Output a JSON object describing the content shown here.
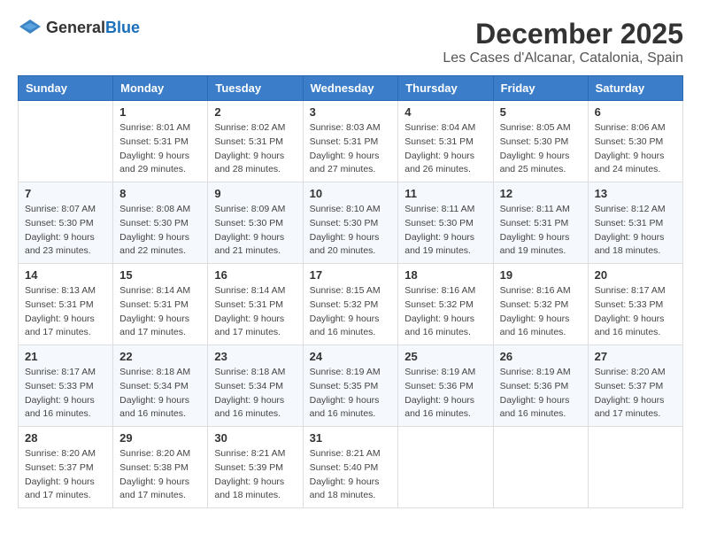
{
  "header": {
    "logo_general": "General",
    "logo_blue": "Blue",
    "month": "December 2025",
    "location": "Les Cases d'Alcanar, Catalonia, Spain"
  },
  "weekdays": [
    "Sunday",
    "Monday",
    "Tuesday",
    "Wednesday",
    "Thursday",
    "Friday",
    "Saturday"
  ],
  "weeks": [
    [
      {
        "day": "",
        "sunrise": "",
        "sunset": "",
        "daylight": ""
      },
      {
        "day": "1",
        "sunrise": "Sunrise: 8:01 AM",
        "sunset": "Sunset: 5:31 PM",
        "daylight": "Daylight: 9 hours and 29 minutes."
      },
      {
        "day": "2",
        "sunrise": "Sunrise: 8:02 AM",
        "sunset": "Sunset: 5:31 PM",
        "daylight": "Daylight: 9 hours and 28 minutes."
      },
      {
        "day": "3",
        "sunrise": "Sunrise: 8:03 AM",
        "sunset": "Sunset: 5:31 PM",
        "daylight": "Daylight: 9 hours and 27 minutes."
      },
      {
        "day": "4",
        "sunrise": "Sunrise: 8:04 AM",
        "sunset": "Sunset: 5:31 PM",
        "daylight": "Daylight: 9 hours and 26 minutes."
      },
      {
        "day": "5",
        "sunrise": "Sunrise: 8:05 AM",
        "sunset": "Sunset: 5:30 PM",
        "daylight": "Daylight: 9 hours and 25 minutes."
      },
      {
        "day": "6",
        "sunrise": "Sunrise: 8:06 AM",
        "sunset": "Sunset: 5:30 PM",
        "daylight": "Daylight: 9 hours and 24 minutes."
      }
    ],
    [
      {
        "day": "7",
        "sunrise": "Sunrise: 8:07 AM",
        "sunset": "Sunset: 5:30 PM",
        "daylight": "Daylight: 9 hours and 23 minutes."
      },
      {
        "day": "8",
        "sunrise": "Sunrise: 8:08 AM",
        "sunset": "Sunset: 5:30 PM",
        "daylight": "Daylight: 9 hours and 22 minutes."
      },
      {
        "day": "9",
        "sunrise": "Sunrise: 8:09 AM",
        "sunset": "Sunset: 5:30 PM",
        "daylight": "Daylight: 9 hours and 21 minutes."
      },
      {
        "day": "10",
        "sunrise": "Sunrise: 8:10 AM",
        "sunset": "Sunset: 5:30 PM",
        "daylight": "Daylight: 9 hours and 20 minutes."
      },
      {
        "day": "11",
        "sunrise": "Sunrise: 8:11 AM",
        "sunset": "Sunset: 5:30 PM",
        "daylight": "Daylight: 9 hours and 19 minutes."
      },
      {
        "day": "12",
        "sunrise": "Sunrise: 8:11 AM",
        "sunset": "Sunset: 5:31 PM",
        "daylight": "Daylight: 9 hours and 19 minutes."
      },
      {
        "day": "13",
        "sunrise": "Sunrise: 8:12 AM",
        "sunset": "Sunset: 5:31 PM",
        "daylight": "Daylight: 9 hours and 18 minutes."
      }
    ],
    [
      {
        "day": "14",
        "sunrise": "Sunrise: 8:13 AM",
        "sunset": "Sunset: 5:31 PM",
        "daylight": "Daylight: 9 hours and 17 minutes."
      },
      {
        "day": "15",
        "sunrise": "Sunrise: 8:14 AM",
        "sunset": "Sunset: 5:31 PM",
        "daylight": "Daylight: 9 hours and 17 minutes."
      },
      {
        "day": "16",
        "sunrise": "Sunrise: 8:14 AM",
        "sunset": "Sunset: 5:31 PM",
        "daylight": "Daylight: 9 hours and 17 minutes."
      },
      {
        "day": "17",
        "sunrise": "Sunrise: 8:15 AM",
        "sunset": "Sunset: 5:32 PM",
        "daylight": "Daylight: 9 hours and 16 minutes."
      },
      {
        "day": "18",
        "sunrise": "Sunrise: 8:16 AM",
        "sunset": "Sunset: 5:32 PM",
        "daylight": "Daylight: 9 hours and 16 minutes."
      },
      {
        "day": "19",
        "sunrise": "Sunrise: 8:16 AM",
        "sunset": "Sunset: 5:32 PM",
        "daylight": "Daylight: 9 hours and 16 minutes."
      },
      {
        "day": "20",
        "sunrise": "Sunrise: 8:17 AM",
        "sunset": "Sunset: 5:33 PM",
        "daylight": "Daylight: 9 hours and 16 minutes."
      }
    ],
    [
      {
        "day": "21",
        "sunrise": "Sunrise: 8:17 AM",
        "sunset": "Sunset: 5:33 PM",
        "daylight": "Daylight: 9 hours and 16 minutes."
      },
      {
        "day": "22",
        "sunrise": "Sunrise: 8:18 AM",
        "sunset": "Sunset: 5:34 PM",
        "daylight": "Daylight: 9 hours and 16 minutes."
      },
      {
        "day": "23",
        "sunrise": "Sunrise: 8:18 AM",
        "sunset": "Sunset: 5:34 PM",
        "daylight": "Daylight: 9 hours and 16 minutes."
      },
      {
        "day": "24",
        "sunrise": "Sunrise: 8:19 AM",
        "sunset": "Sunset: 5:35 PM",
        "daylight": "Daylight: 9 hours and 16 minutes."
      },
      {
        "day": "25",
        "sunrise": "Sunrise: 8:19 AM",
        "sunset": "Sunset: 5:36 PM",
        "daylight": "Daylight: 9 hours and 16 minutes."
      },
      {
        "day": "26",
        "sunrise": "Sunrise: 8:19 AM",
        "sunset": "Sunset: 5:36 PM",
        "daylight": "Daylight: 9 hours and 16 minutes."
      },
      {
        "day": "27",
        "sunrise": "Sunrise: 8:20 AM",
        "sunset": "Sunset: 5:37 PM",
        "daylight": "Daylight: 9 hours and 17 minutes."
      }
    ],
    [
      {
        "day": "28",
        "sunrise": "Sunrise: 8:20 AM",
        "sunset": "Sunset: 5:37 PM",
        "daylight": "Daylight: 9 hours and 17 minutes."
      },
      {
        "day": "29",
        "sunrise": "Sunrise: 8:20 AM",
        "sunset": "Sunset: 5:38 PM",
        "daylight": "Daylight: 9 hours and 17 minutes."
      },
      {
        "day": "30",
        "sunrise": "Sunrise: 8:21 AM",
        "sunset": "Sunset: 5:39 PM",
        "daylight": "Daylight: 9 hours and 18 minutes."
      },
      {
        "day": "31",
        "sunrise": "Sunrise: 8:21 AM",
        "sunset": "Sunset: 5:40 PM",
        "daylight": "Daylight: 9 hours and 18 minutes."
      },
      {
        "day": "",
        "sunrise": "",
        "sunset": "",
        "daylight": ""
      },
      {
        "day": "",
        "sunrise": "",
        "sunset": "",
        "daylight": ""
      },
      {
        "day": "",
        "sunrise": "",
        "sunset": "",
        "daylight": ""
      }
    ]
  ]
}
